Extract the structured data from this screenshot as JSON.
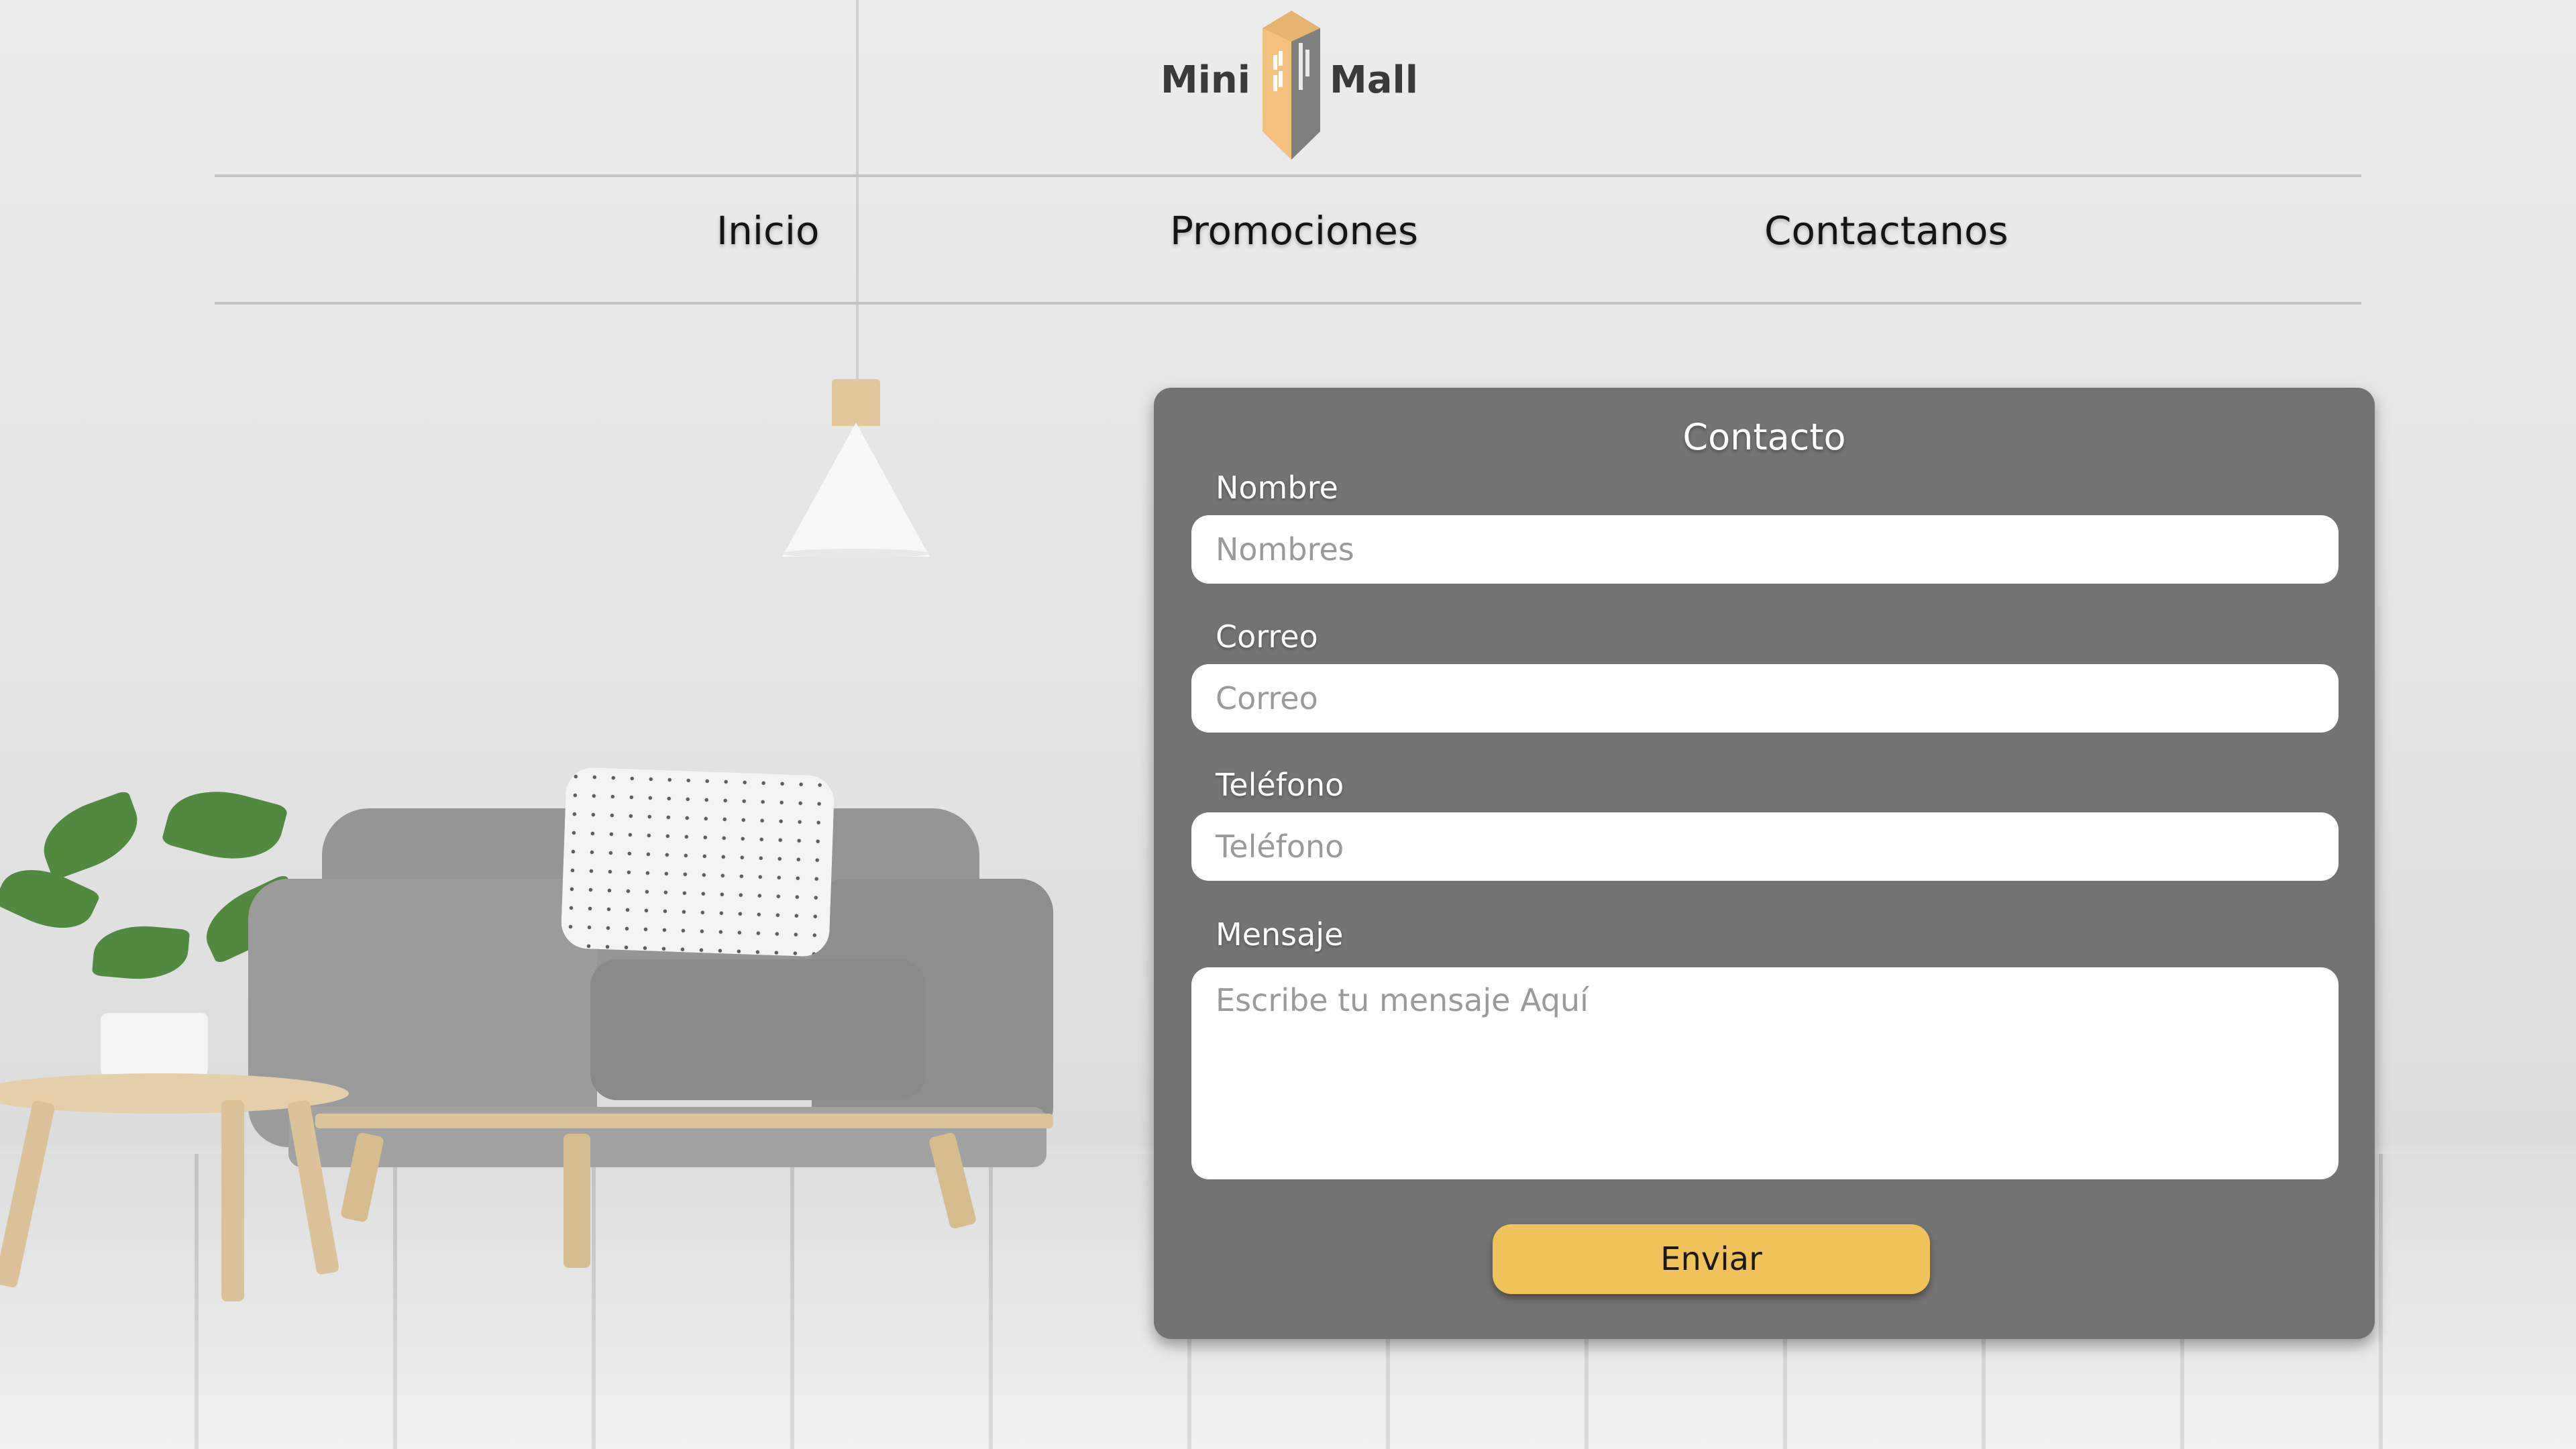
{
  "brand": {
    "left_text": "Mini",
    "right_text": "Mall",
    "logo_icon": "building-icon",
    "colors": {
      "light": "#f5c27d",
      "dark": "#7f7f7f"
    }
  },
  "nav": {
    "items": [
      {
        "label": "Inicio"
      },
      {
        "label": "Promociones"
      },
      {
        "label": "Contactanos"
      }
    ]
  },
  "contact_form": {
    "title": "Contacto",
    "fields": [
      {
        "label": "Nombre",
        "placeholder": "Nombres",
        "value": ""
      },
      {
        "label": "Correo",
        "placeholder": "Correo",
        "value": ""
      },
      {
        "label": "Teléfono",
        "placeholder": "Teléfono",
        "value": ""
      }
    ],
    "message": {
      "label": "Mensaje",
      "placeholder": "Escribe tu mensaje Aquí",
      "value": ""
    },
    "submit_label": "Enviar"
  },
  "colors": {
    "card_bg": "#737373",
    "button_bg": "#efc25a",
    "input_bg": "#ffffff",
    "nav_text": "#141414"
  }
}
